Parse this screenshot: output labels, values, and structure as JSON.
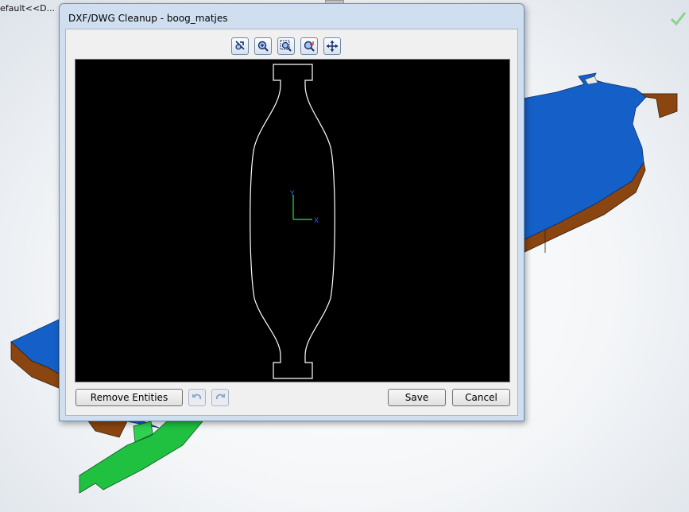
{
  "background": {
    "origin_text": "efault<<D...",
    "colors": {
      "model_blue": "#1560c8",
      "model_side": "#8a4510",
      "model_green": "#20c040",
      "check": "#8fd08f"
    }
  },
  "dialog": {
    "title": "DXF/DWG Cleanup - boog_matjes",
    "toolbar": [
      {
        "icon": "zoom-fit-icon"
      },
      {
        "icon": "zoom-in-out-icon"
      },
      {
        "icon": "zoom-area-icon"
      },
      {
        "icon": "zoom-prev-icon"
      },
      {
        "icon": "pan-icon"
      }
    ],
    "axes": {
      "x_label": "X",
      "y_label": "Y"
    },
    "buttons": {
      "remove_entities": "Remove Entities",
      "undo_icon": "undo-icon",
      "redo_icon": "redo-icon",
      "save": "Save",
      "cancel": "Cancel"
    }
  }
}
